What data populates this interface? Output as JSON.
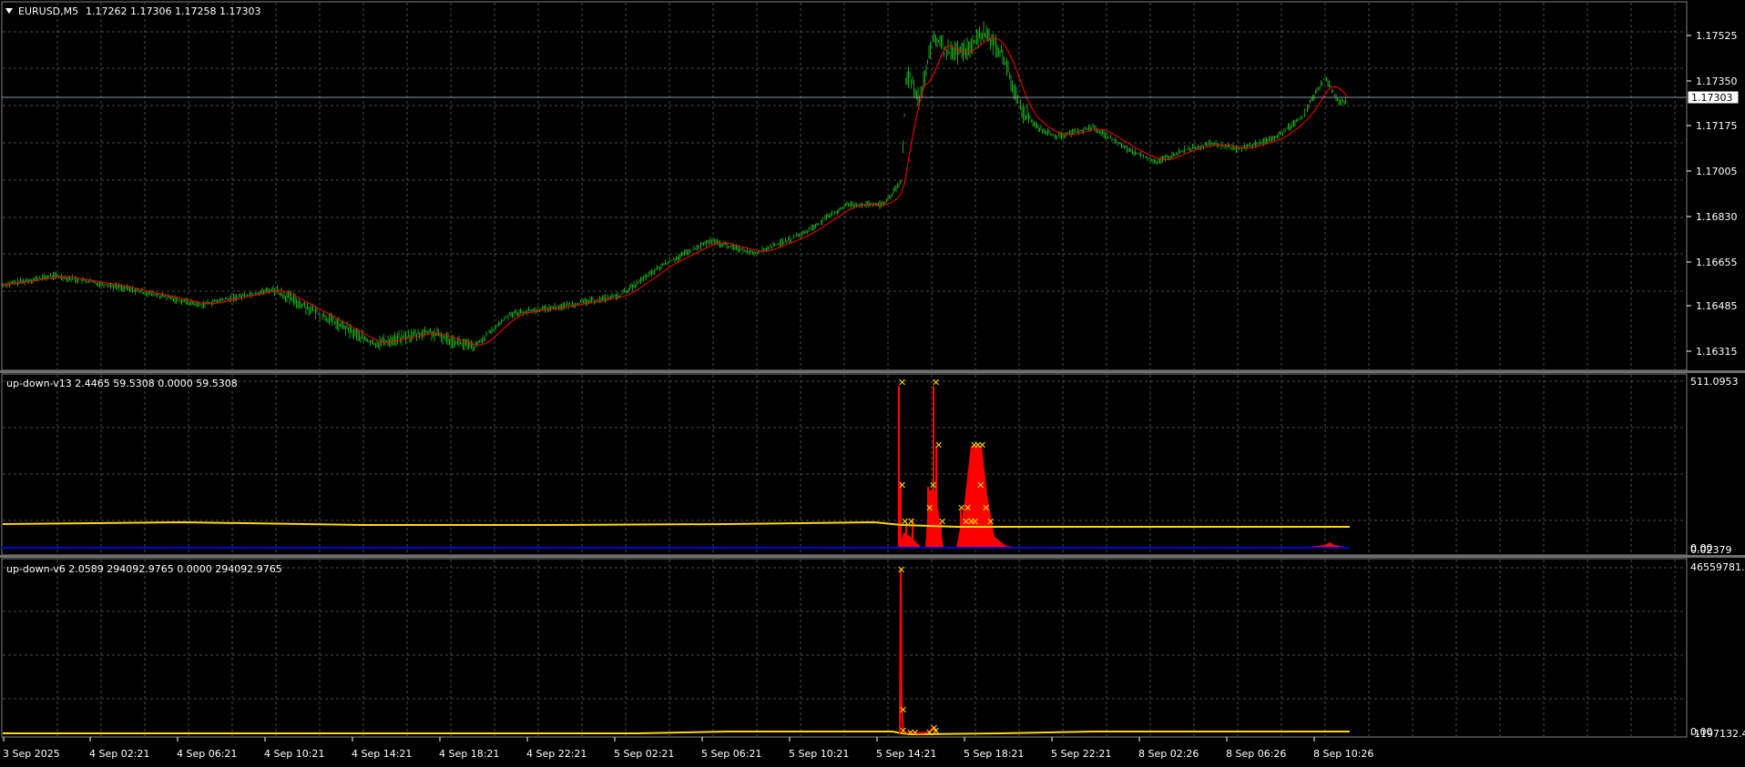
{
  "main": {
    "symbol_label": "EURUSD,M5",
    "ohlc": "1.17262 1.17306 1.17258 1.17303",
    "current_price_label": "1.17303",
    "price_ticks": [
      "1.17525",
      "1.17350",
      "1.17175",
      "1.17005",
      "1.16830",
      "1.16655",
      "1.16485",
      "1.16315"
    ]
  },
  "indicator1": {
    "label": "up-down-v13 2.4465 59.5308 0.0000 59.5308",
    "top_value": "511.0953",
    "bottom_value": "0.02379",
    "overlap_value": "0.00"
  },
  "indicator2": {
    "label": "up-down-v6 2.0589 294092.9765 0.0000 294092.9765",
    "top_value": "46559781.",
    "bottom_value": "-1197132.4",
    "overlap_value": "0.00"
  },
  "time_axis": {
    "labels": [
      "3 Sep 2025",
      "4 Sep 02:21",
      "4 Sep 06:21",
      "4 Sep 10:21",
      "4 Sep 14:21",
      "4 Sep 18:21",
      "4 Sep 22:21",
      "5 Sep 02:21",
      "5 Sep 06:21",
      "5 Sep 10:21",
      "5 Sep 14:21",
      "5 Sep 18:21",
      "5 Sep 22:21",
      "8 Sep 02:26",
      "8 Sep 06:26",
      "8 Sep 10:26"
    ]
  },
  "colors": {
    "background": "#000000",
    "grid": "#4a4a4a",
    "price_line": "#1aa01a",
    "moving_average": "#ff0000",
    "histogram": "#ff0000",
    "signal_line": "#ffd700",
    "markers": "#ffd700",
    "baseline": "#0000cc",
    "bid_line": "#8a9bb5"
  },
  "icons": {
    "collapse": "triangle-down-icon",
    "marker": "x-marker-icon"
  }
}
